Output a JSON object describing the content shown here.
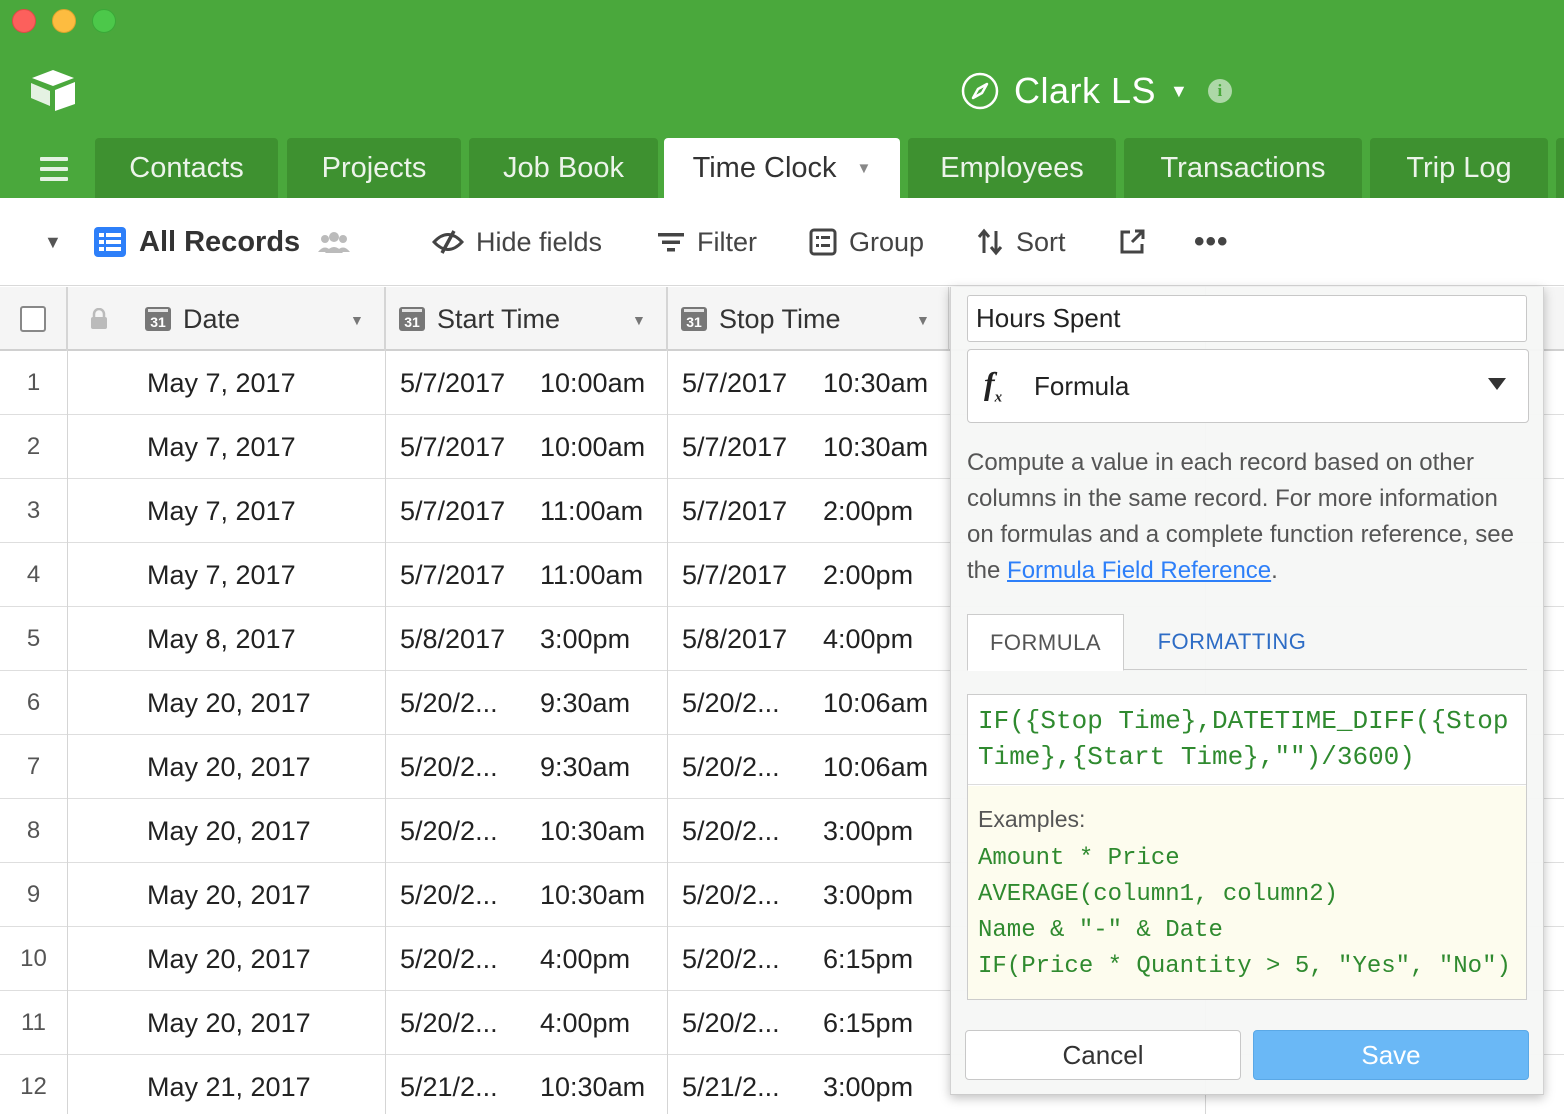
{
  "window": {
    "traffic_lights": [
      "close",
      "minimize",
      "zoom"
    ]
  },
  "base": {
    "title": "Clark LS"
  },
  "tables": [
    {
      "label": "Contacts"
    },
    {
      "label": "Projects"
    },
    {
      "label": "Job Book"
    },
    {
      "label": "Time Clock"
    },
    {
      "label": "Employees"
    },
    {
      "label": "Transactions"
    },
    {
      "label": "Trip Log"
    }
  ],
  "active_table": "Time Clock",
  "toolbar": {
    "view_name": "All Records",
    "hide_fields": "Hide fields",
    "filter": "Filter",
    "group": "Group",
    "sort": "Sort"
  },
  "grid": {
    "columns": [
      {
        "label": "Date"
      },
      {
        "label": "Start Time"
      },
      {
        "label": "Stop Time"
      }
    ],
    "rows": [
      {
        "num": "1",
        "date": "May 7, 2017",
        "start_date": "5/7/2017",
        "start_time": "10:00am",
        "stop_date": "5/7/2017",
        "stop_time": "10:30am"
      },
      {
        "num": "2",
        "date": "May 7, 2017",
        "start_date": "5/7/2017",
        "start_time": "10:00am",
        "stop_date": "5/7/2017",
        "stop_time": "10:30am"
      },
      {
        "num": "3",
        "date": "May 7, 2017",
        "start_date": "5/7/2017",
        "start_time": "11:00am",
        "stop_date": "5/7/2017",
        "stop_time": "2:00pm"
      },
      {
        "num": "4",
        "date": "May 7, 2017",
        "start_date": "5/7/2017",
        "start_time": "11:00am",
        "stop_date": "5/7/2017",
        "stop_time": "2:00pm"
      },
      {
        "num": "5",
        "date": "May 8, 2017",
        "start_date": "5/8/2017",
        "start_time": "3:00pm",
        "stop_date": "5/8/2017",
        "stop_time": "4:00pm"
      },
      {
        "num": "6",
        "date": "May 20, 2017",
        "start_date": "5/20/2...",
        "start_time": "9:30am",
        "stop_date": "5/20/2...",
        "stop_time": "10:06am"
      },
      {
        "num": "7",
        "date": "May 20, 2017",
        "start_date": "5/20/2...",
        "start_time": "9:30am",
        "stop_date": "5/20/2...",
        "stop_time": "10:06am"
      },
      {
        "num": "8",
        "date": "May 20, 2017",
        "start_date": "5/20/2...",
        "start_time": "10:30am",
        "stop_date": "5/20/2...",
        "stop_time": "3:00pm"
      },
      {
        "num": "9",
        "date": "May 20, 2017",
        "start_date": "5/20/2...",
        "start_time": "10:30am",
        "stop_date": "5/20/2...",
        "stop_time": "3:00pm"
      },
      {
        "num": "10",
        "date": "May 20, 2017",
        "start_date": "5/20/2...",
        "start_time": "4:00pm",
        "stop_date": "5/20/2...",
        "stop_time": "6:15pm"
      },
      {
        "num": "11",
        "date": "May 20, 2017",
        "start_date": "5/20/2...",
        "start_time": "4:00pm",
        "stop_date": "5/20/2...",
        "stop_time": "6:15pm"
      },
      {
        "num": "12",
        "date": "May 21, 2017",
        "start_date": "5/21/2...",
        "start_time": "10:30am",
        "stop_date": "5/21/2...",
        "stop_time": "3:00pm"
      }
    ]
  },
  "field_editor": {
    "field_name": "Hours Spent",
    "field_type": "Formula",
    "description_text": "Compute a value in each record based on other columns in the same record. For more information on formulas and a complete function reference, see the ",
    "description_link": "Formula Field Reference",
    "description_end": ".",
    "tabs": {
      "formula": "FORMULA",
      "formatting": "FORMATTING"
    },
    "formula": "IF({Stop Time},DATETIME_DIFF({Stop Time},{Start Time},\"\")/3600)",
    "examples_title": "Examples:",
    "examples": [
      "Amount * Price",
      "AVERAGE(column1, column2)",
      "Name & \"-\" & Date",
      "IF(Price * Quantity > 5, \"Yes\", \"No\")"
    ],
    "cancel_label": "Cancel",
    "save_label": "Save"
  },
  "colors": {
    "header_green": "#4aa83c",
    "tab_dark_green": "#3e9130",
    "save_blue": "#6ab8f6",
    "formula_green": "#2f8a2f",
    "link_blue": "#2d7ff9"
  }
}
